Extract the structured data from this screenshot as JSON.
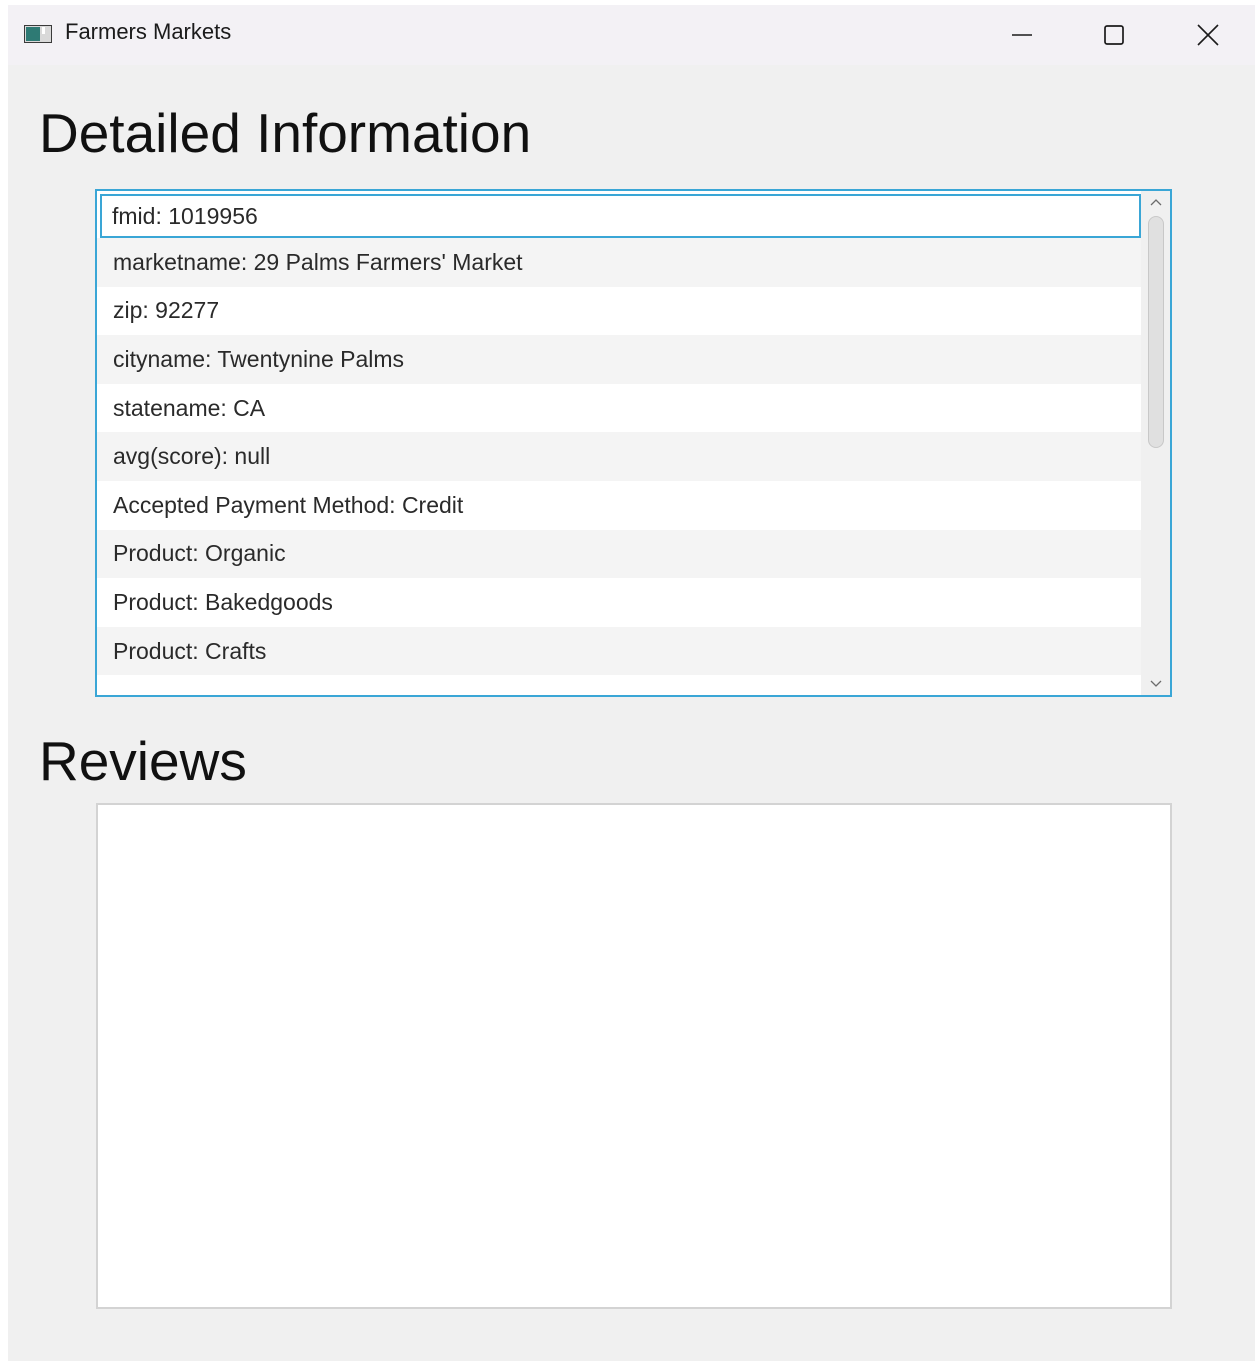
{
  "window": {
    "title": "Farmers Markets",
    "icon": "app-window-icon",
    "controls": [
      "minimize-icon",
      "maximize-icon",
      "close-icon"
    ]
  },
  "detail": {
    "heading": "Detailed Information",
    "items": [
      {
        "label": "fmid: 1019956"
      },
      {
        "label": "marketname: 29 Palms Farmers' Market"
      },
      {
        "label": "zip: 92277"
      },
      {
        "label": "cityname: Twentynine Palms"
      },
      {
        "label": "statename: CA"
      },
      {
        "label": "avg(score): null"
      },
      {
        "label": "Accepted Payment Method: Credit"
      },
      {
        "label": "Product: Organic"
      },
      {
        "label": "Product: Bakedgoods"
      },
      {
        "label": "Product: Crafts"
      }
    ],
    "selected_index": 0
  },
  "reviews": {
    "heading": "Reviews",
    "items": []
  },
  "colors": {
    "accent": "#3aa6d6",
    "window_bg": "#f0f0f0",
    "titlebar_bg": "#f3f1f5"
  }
}
